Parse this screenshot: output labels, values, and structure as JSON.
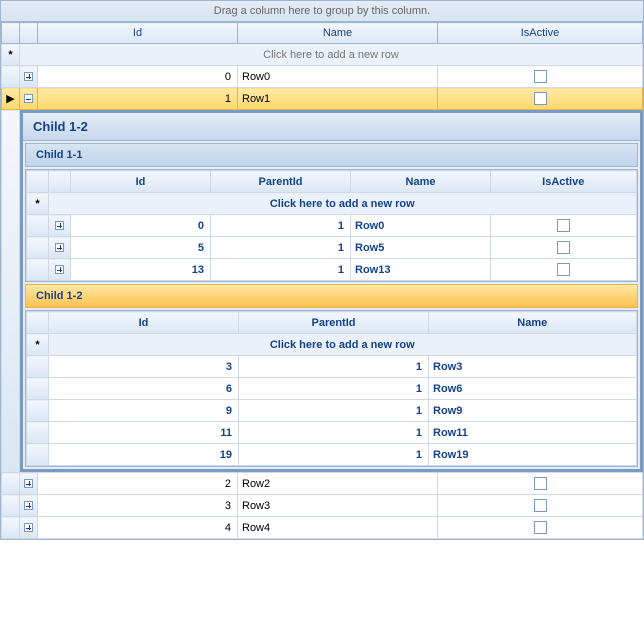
{
  "groupPanel": "Drag a column here to group by this column.",
  "newRowText": "Click here to add a new row",
  "indicators": {
    "star": "*",
    "arrow": "▶"
  },
  "master": {
    "columns": [
      "Id",
      "Name",
      "IsActive"
    ],
    "rows": [
      {
        "id": 0,
        "name": "Row0",
        "active": false,
        "expanded": false,
        "selected": false
      },
      {
        "id": 1,
        "name": "Row1",
        "active": false,
        "expanded": true,
        "selected": true
      },
      {
        "id": 2,
        "name": "Row2",
        "active": false,
        "expanded": false,
        "selected": false
      },
      {
        "id": 3,
        "name": "Row3",
        "active": false,
        "expanded": false,
        "selected": false
      },
      {
        "id": 4,
        "name": "Row4",
        "active": false,
        "expanded": false,
        "selected": false
      }
    ]
  },
  "detail": {
    "activeTab": "Child 1-2",
    "child1": {
      "title": "Child 1-1",
      "columns": [
        "Id",
        "ParentId",
        "Name",
        "IsActive"
      ],
      "rows": [
        {
          "id": 0,
          "parentId": 1,
          "name": "Row0"
        },
        {
          "id": 5,
          "parentId": 1,
          "name": "Row5"
        },
        {
          "id": 13,
          "parentId": 1,
          "name": "Row13"
        }
      ]
    },
    "child2": {
      "title": "Child 1-2",
      "columns": [
        "Id",
        "ParentId",
        "Name"
      ],
      "rows": [
        {
          "id": 3,
          "parentId": 1,
          "name": "Row3"
        },
        {
          "id": 6,
          "parentId": 1,
          "name": "Row6"
        },
        {
          "id": 9,
          "parentId": 1,
          "name": "Row9"
        },
        {
          "id": 11,
          "parentId": 1,
          "name": "Row11"
        },
        {
          "id": 19,
          "parentId": 1,
          "name": "Row19"
        }
      ]
    }
  }
}
